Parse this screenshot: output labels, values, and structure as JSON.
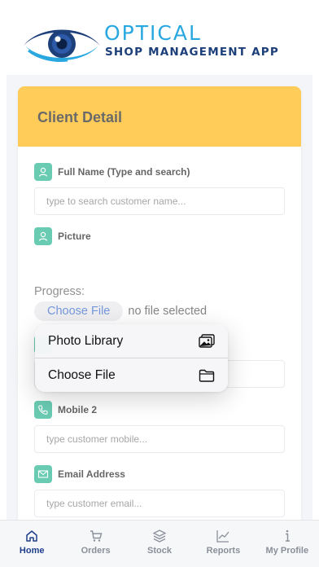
{
  "brand": {
    "title": "OPTICAL",
    "subtitle": "SHOP MANAGEMENT APP"
  },
  "card": {
    "title": "Client Detail"
  },
  "fields": {
    "full_name": {
      "label": "Full Name (Type and search)",
      "placeholder": "type to search customer name..."
    },
    "picture": {
      "label": "Picture"
    },
    "mobile2": {
      "label": "Mobile 2",
      "placeholder": "type customer mobile..."
    },
    "email": {
      "label": "Email Address",
      "placeholder": "type customer email..."
    }
  },
  "upload": {
    "progress_label": "Progress:",
    "choose_button": "Choose File",
    "status": "no file selected"
  },
  "popover": {
    "items": [
      {
        "label": "Photo Library",
        "icon": "photo-library-icon"
      },
      {
        "label": "Choose File",
        "icon": "folder-icon"
      }
    ]
  },
  "nav": {
    "items": [
      {
        "label": "Home",
        "icon": "home-icon",
        "active": true
      },
      {
        "label": "Orders",
        "icon": "cart-icon",
        "active": false
      },
      {
        "label": "Stock",
        "icon": "layers-icon",
        "active": false
      },
      {
        "label": "Reports",
        "icon": "chart-icon",
        "active": false
      },
      {
        "label": "My Profile",
        "icon": "info-icon",
        "active": false
      }
    ]
  },
  "colors": {
    "accent": "#ffb000",
    "field_icon": "#1bb08a",
    "nav_active": "#1f3e8a",
    "logo_blue": "#29a8e0"
  }
}
